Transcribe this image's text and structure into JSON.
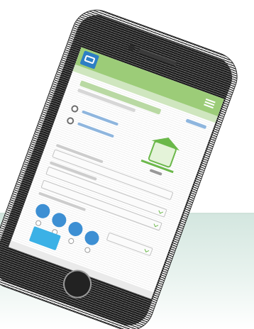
{
  "scene": {
    "description_free": true
  },
  "colors": {
    "header_green": "#9ccc78",
    "accent_green": "#6bb84a",
    "accent_blue": "#3d8fd3",
    "button_blue": "#3bb1e6",
    "background_band": "#d3e6df"
  },
  "icons": {
    "logo": "app-logo-icon",
    "menu": "hamburger-menu-icon",
    "illustration": "house-illustration-icon"
  }
}
